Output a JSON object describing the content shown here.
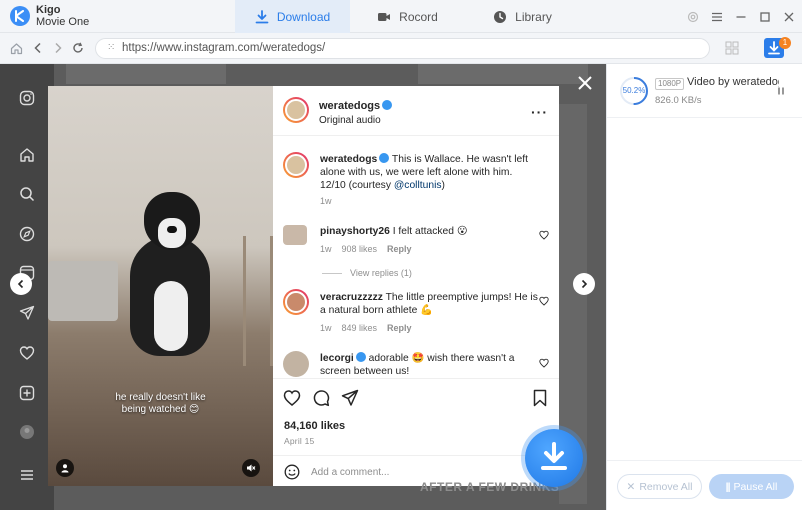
{
  "app": {
    "name_line1": "Kigo",
    "name_line2": "Movie One",
    "brand_color": "#3b8ef6",
    "accent_color": "#2b7de9",
    "logo_icon": "k-logo-icon"
  },
  "tabs": [
    {
      "label": "Download",
      "icon": "download-icon",
      "active": true
    },
    {
      "label": "Rocord",
      "icon": "video-camera-icon",
      "active": false
    },
    {
      "label": "Library",
      "icon": "clock-icon",
      "active": false
    }
  ],
  "window_controls": [
    "settings-icon",
    "menu-icon",
    "minimize-icon",
    "maximize-icon",
    "close-icon"
  ],
  "address_bar": {
    "url": "https://www.instagram.com/weratedogs/",
    "download_badge_count": "1"
  },
  "ig_sidebar_icons": [
    "instagram-icon",
    "home-icon",
    "search-icon",
    "explore-icon",
    "reels-icon",
    "send-icon",
    "heart-icon",
    "create-icon",
    "profile-icon",
    "menu-icon"
  ],
  "post": {
    "media_caption_line1": "he really doesn't like",
    "media_caption_line2": "being watched",
    "author": "weratedogs",
    "audio": "Original audio",
    "caption_text": "This is Wallace. He wasn't left alone with us, we were left alone with him. 12/10 (courtesy",
    "caption_mention": "@colltunis",
    "caption_end": ")",
    "caption_time": "1w",
    "comments": [
      {
        "user": "pinayshorty26",
        "text": "I felt attacked",
        "emoji": "😮",
        "time": "1w",
        "likes": "908 likes",
        "reply": "Reply",
        "view_replies": "View replies (1)"
      },
      {
        "user": "veracruzzzzz",
        "text": "The little preemptive jumps! He is a natural born athlete",
        "emoji": "💪",
        "time": "1w",
        "likes": "849 likes",
        "reply": "Reply"
      },
      {
        "user": "lecorgi",
        "text": "adorable",
        "emoji": "🤩",
        "text2": "wish there wasn't a screen between us!"
      }
    ],
    "likes": "84,160 likes",
    "date": "April 15",
    "comment_placeholder": "Add a comment...",
    "background_overlay_text": "AFTER A FEW DRINKS"
  },
  "download_panel": {
    "item": {
      "progress_text": "50.2%",
      "progress": 0.502,
      "resolution": "1080P",
      "title": "Video by weratedogs",
      "speed": "826.0 KB/s"
    },
    "remove_all": "Remove All",
    "pause_all": "Pause All"
  }
}
